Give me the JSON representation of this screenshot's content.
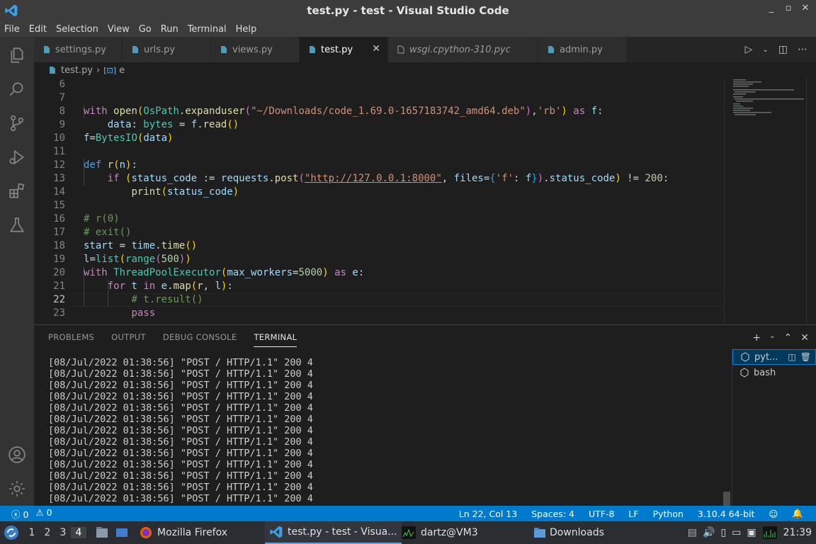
{
  "window": {
    "title": "test.py - test - Visual Studio Code"
  },
  "menu": [
    "File",
    "Edit",
    "Selection",
    "View",
    "Go",
    "Run",
    "Terminal",
    "Help"
  ],
  "tabs": [
    {
      "label": "settings.py",
      "active": false,
      "italic": false
    },
    {
      "label": "urls.py",
      "active": false,
      "italic": false
    },
    {
      "label": "views.py",
      "active": false,
      "italic": false
    },
    {
      "label": "test.py",
      "active": true,
      "italic": false
    },
    {
      "label": "wsgi.cpython-310.pyc",
      "active": false,
      "italic": true
    },
    {
      "label": "admin.py",
      "active": false,
      "italic": false
    }
  ],
  "breadcrumb": {
    "file": "test.py",
    "symbol": "e"
  },
  "editor": {
    "current_line": 22,
    "lines": [
      {
        "n": 6
      },
      {
        "n": 7
      },
      {
        "n": 8
      },
      {
        "n": 9
      },
      {
        "n": 10
      },
      {
        "n": 11
      },
      {
        "n": 12
      },
      {
        "n": 13
      },
      {
        "n": 14
      },
      {
        "n": 15
      },
      {
        "n": 16
      },
      {
        "n": 17
      },
      {
        "n": 18
      },
      {
        "n": 19
      },
      {
        "n": 20
      },
      {
        "n": 21
      },
      {
        "n": 22
      },
      {
        "n": 23
      }
    ]
  },
  "code": {
    "l7": {
      "with": "with",
      "open": "open",
      "ospath": "OsPath",
      "expand": "expanduser",
      "path": "\"~/Downloads/code_1.69.0-1657183742_amd64.deb\"",
      "mode": "'rb'",
      "as": "as",
      "f": "f"
    },
    "l8": {
      "data": "data",
      "bytes": "bytes",
      "f": "f",
      "read": "read"
    },
    "l9": {
      "f": "f",
      "bytesio": "BytesIO",
      "data": "data"
    },
    "l11": {
      "def": "def",
      "r": "r",
      "n": "n"
    },
    "l12": {
      "if": "if",
      "status_code": "status_code",
      "requests": "requests",
      "post": "post",
      "url": "\"http://127.0.0.1:8000\"",
      "files": "files",
      "fkey": "'f'",
      "f": "f",
      "sc2": "status_code",
      "num": "200"
    },
    "l13": {
      "print": "print",
      "status_code": "status_code"
    },
    "l15": "# r(0)",
    "l16": "# exit()",
    "l17": {
      "start": "start",
      "time": "time",
      "time2": "time"
    },
    "l18": {
      "l": "l",
      "list": "list",
      "range": "range",
      "num": "500"
    },
    "l19": {
      "with": "with",
      "tpe": "ThreadPoolExecutor",
      "mw": "max_workers",
      "num": "5000",
      "as": "as",
      "e": "e"
    },
    "l20": {
      "for": "for",
      "t": "t",
      "in": "in",
      "e": "e",
      "map": "map",
      "r": "r",
      "l": "l"
    },
    "l21": "# t.result()",
    "l22": "pass"
  },
  "panel": {
    "tabs": [
      "PROBLEMS",
      "OUTPUT",
      "DEBUG CONSOLE",
      "TERMINAL"
    ],
    "active_tab": "TERMINAL",
    "terminal_lines": [
      "[08/Jul/2022 01:38:56] \"POST / HTTP/1.1\" 200 4",
      "[08/Jul/2022 01:38:56] \"POST / HTTP/1.1\" 200 4",
      "[08/Jul/2022 01:38:56] \"POST / HTTP/1.1\" 200 4",
      "[08/Jul/2022 01:38:56] \"POST / HTTP/1.1\" 200 4",
      "[08/Jul/2022 01:38:56] \"POST / HTTP/1.1\" 200 4",
      "[08/Jul/2022 01:38:56] \"POST / HTTP/1.1\" 200 4",
      "[08/Jul/2022 01:38:56] \"POST / HTTP/1.1\" 200 4",
      "[08/Jul/2022 01:38:56] \"POST / HTTP/1.1\" 200 4",
      "[08/Jul/2022 01:38:56] \"POST / HTTP/1.1\" 200 4",
      "[08/Jul/2022 01:38:56] \"POST / HTTP/1.1\" 200 4",
      "[08/Jul/2022 01:38:56] \"POST / HTTP/1.1\" 200 4",
      "[08/Jul/2022 01:38:56] \"POST / HTTP/1.1\" 200 4",
      "[08/Jul/2022 01:38:56] \"POST / HTTP/1.1\" 200 4"
    ],
    "terminals": [
      "pyt...",
      "bash"
    ]
  },
  "status": {
    "errors": "0",
    "warnings": "0",
    "position": "Ln 22, Col 13",
    "spaces": "Spaces: 4",
    "encoding": "UTF-8",
    "eol": "LF",
    "language": "Python",
    "interpreter": "3.10.4 64-bit"
  },
  "taskbar": {
    "workspaces": [
      "1",
      "2",
      "3",
      "4"
    ],
    "active_workspace": "4",
    "tasks": [
      "Mozilla Firefox",
      "test.py - test - Visua...",
      "dartz@VM3",
      "Downloads"
    ],
    "clock": "21:39"
  },
  "colors": {
    "accent": "#007acc",
    "titlebar": "#3c3c3c",
    "editor_bg": "#1e1e1e"
  }
}
